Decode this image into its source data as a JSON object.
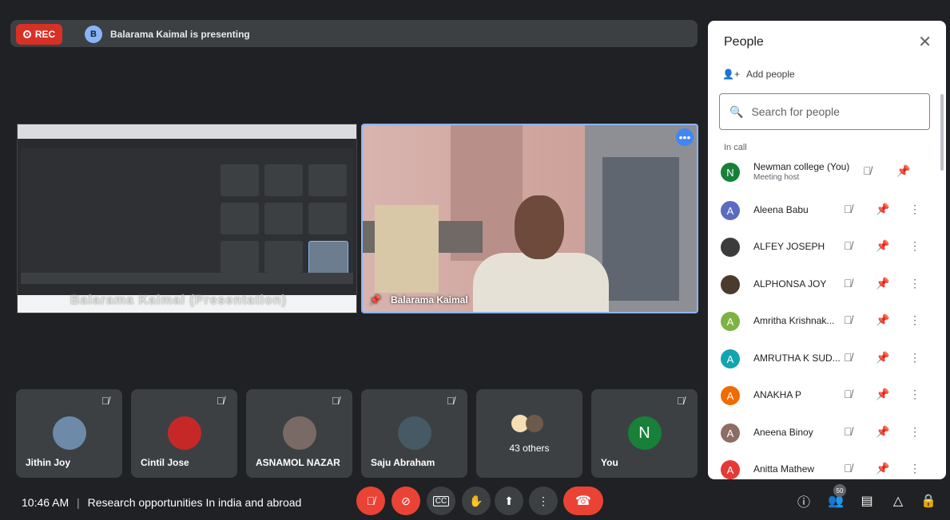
{
  "topbar": {
    "rec_label": "REC",
    "presenter_initial": "B",
    "presenting_text": "Balarama Kaimal is presenting"
  },
  "share_tile": {
    "label": "Balarama Kaimal (Presentation)"
  },
  "camera_tile": {
    "name": "Balarama Kaimal",
    "more_label": "•••"
  },
  "tiles": [
    {
      "name": "Jithin Joy"
    },
    {
      "name": "Cintil Jose"
    },
    {
      "name": "ASNAMOL NAZAR"
    },
    {
      "name": "Saju Abraham"
    },
    {
      "name": "43 others"
    },
    {
      "name": "You",
      "initial": "N"
    }
  ],
  "people_panel": {
    "title": "People",
    "add_label": "Add people",
    "search_placeholder": "Search for people",
    "section_label": "In call",
    "participants": [
      {
        "initial": "N",
        "name": "Newman college (You)",
        "sub": "Meeting host",
        "color": "#188038"
      },
      {
        "initial": "A",
        "name": "Aleena Babu",
        "color": "#5c6bc0"
      },
      {
        "initial": "",
        "name": "ALFEY JOSEPH",
        "color": "#3c3c3c"
      },
      {
        "initial": "",
        "name": "ALPHONSA JOY",
        "color": "#4a3b2c"
      },
      {
        "initial": "A",
        "name": "Amritha Krishnak...",
        "color": "#7cb342"
      },
      {
        "initial": "A",
        "name": "AMRUTHA K SUD...",
        "color": "#12a4af"
      },
      {
        "initial": "A",
        "name": "ANAKHA P",
        "color": "#ef6c00"
      },
      {
        "initial": "A",
        "name": "Aneena Binoy",
        "color": "#8d6e63"
      },
      {
        "initial": "A",
        "name": "Anitta Mathew",
        "color": "#e53935"
      }
    ]
  },
  "bottombar": {
    "time": "10:46 AM",
    "separator": "|",
    "meeting_title": "Research opportunities In india and abroad",
    "people_count": "50"
  }
}
